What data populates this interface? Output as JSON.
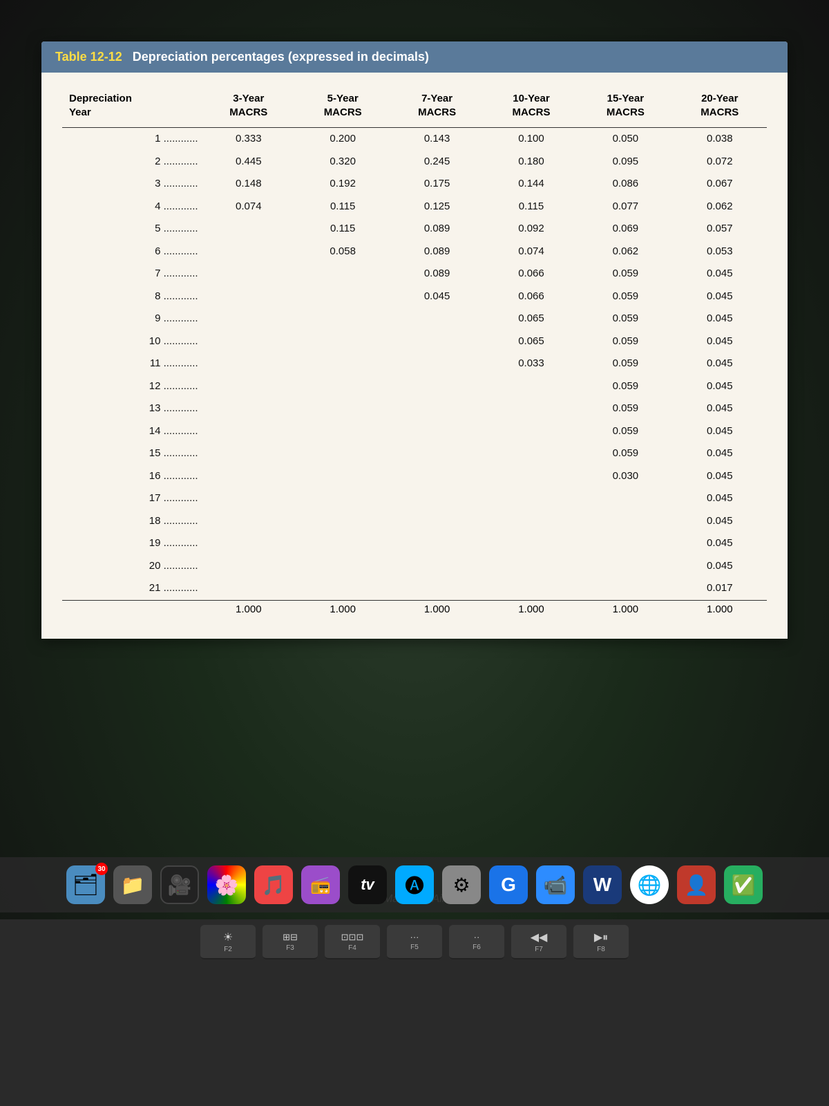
{
  "table": {
    "title_prefix": "Table 12-12",
    "title_text": "Depreciation percentages (expressed in decimals)",
    "columns": [
      {
        "header_line1": "Depreciation",
        "header_line2": "Year"
      },
      {
        "header_line1": "3-Year",
        "header_line2": "MACRS"
      },
      {
        "header_line1": "5-Year",
        "header_line2": "MACRS"
      },
      {
        "header_line1": "7-Year",
        "header_line2": "MACRS"
      },
      {
        "header_line1": "10-Year",
        "header_line2": "MACRS"
      },
      {
        "header_line1": "15-Year",
        "header_line2": "MACRS"
      },
      {
        "header_line1": "20-Year",
        "header_line2": "MACRS"
      }
    ],
    "rows": [
      {
        "year": "1 ............",
        "y3": "0.333",
        "y5": "0.200",
        "y7": "0.143",
        "y10": "0.100",
        "y15": "0.050",
        "y20": "0.038"
      },
      {
        "year": "2 ............",
        "y3": "0.445",
        "y5": "0.320",
        "y7": "0.245",
        "y10": "0.180",
        "y15": "0.095",
        "y20": "0.072"
      },
      {
        "year": "3 ............",
        "y3": "0.148",
        "y5": "0.192",
        "y7": "0.175",
        "y10": "0.144",
        "y15": "0.086",
        "y20": "0.067"
      },
      {
        "year": "4 ............",
        "y3": "0.074",
        "y5": "0.115",
        "y7": "0.125",
        "y10": "0.115",
        "y15": "0.077",
        "y20": "0.062"
      },
      {
        "year": "5 ............",
        "y3": "",
        "y5": "0.115",
        "y7": "0.089",
        "y10": "0.092",
        "y15": "0.069",
        "y20": "0.057"
      },
      {
        "year": "6 ............",
        "y3": "",
        "y5": "0.058",
        "y7": "0.089",
        "y10": "0.074",
        "y15": "0.062",
        "y20": "0.053"
      },
      {
        "year": "7 ............",
        "y3": "",
        "y5": "",
        "y7": "0.089",
        "y10": "0.066",
        "y15": "0.059",
        "y20": "0.045"
      },
      {
        "year": "8 ............",
        "y3": "",
        "y5": "",
        "y7": "0.045",
        "y10": "0.066",
        "y15": "0.059",
        "y20": "0.045"
      },
      {
        "year": "9 ............",
        "y3": "",
        "y5": "",
        "y7": "",
        "y10": "0.065",
        "y15": "0.059",
        "y20": "0.045"
      },
      {
        "year": "10 ............",
        "y3": "",
        "y5": "",
        "y7": "",
        "y10": "0.065",
        "y15": "0.059",
        "y20": "0.045"
      },
      {
        "year": "11 ............",
        "y3": "",
        "y5": "",
        "y7": "",
        "y10": "0.033",
        "y15": "0.059",
        "y20": "0.045"
      },
      {
        "year": "12 ............",
        "y3": "",
        "y5": "",
        "y7": "",
        "y10": "",
        "y15": "0.059",
        "y20": "0.045"
      },
      {
        "year": "13 ............",
        "y3": "",
        "y5": "",
        "y7": "",
        "y10": "",
        "y15": "0.059",
        "y20": "0.045"
      },
      {
        "year": "14 ............",
        "y3": "",
        "y5": "",
        "y7": "",
        "y10": "",
        "y15": "0.059",
        "y20": "0.045"
      },
      {
        "year": "15 ............",
        "y3": "",
        "y5": "",
        "y7": "",
        "y10": "",
        "y15": "0.059",
        "y20": "0.045"
      },
      {
        "year": "16 ............",
        "y3": "",
        "y5": "",
        "y7": "",
        "y10": "",
        "y15": "0.030",
        "y20": "0.045"
      },
      {
        "year": "17 ............",
        "y3": "",
        "y5": "",
        "y7": "",
        "y10": "",
        "y15": "",
        "y20": "0.045"
      },
      {
        "year": "18 ............",
        "y3": "",
        "y5": "",
        "y7": "",
        "y10": "",
        "y15": "",
        "y20": "0.045"
      },
      {
        "year": "19 ............",
        "y3": "",
        "y5": "",
        "y7": "",
        "y10": "",
        "y15": "",
        "y20": "0.045"
      },
      {
        "year": "20 ............",
        "y3": "",
        "y5": "",
        "y7": "",
        "y10": "",
        "y15": "",
        "y20": "0.045"
      },
      {
        "year": "21 ............",
        "y3": "",
        "y5": "",
        "y7": "",
        "y10": "",
        "y15": "",
        "y20": "0.017"
      }
    ],
    "totals": [
      "",
      "1.000",
      "1.000",
      "1.000",
      "1.000",
      "1.000",
      "1.000"
    ]
  },
  "dock": {
    "badge_label": "30",
    "macbook_text": "MacBook Air"
  },
  "keyboard": {
    "keys": [
      {
        "icon": "☀",
        "label": "F2"
      },
      {
        "icon": "⊞",
        "label": "F3"
      },
      {
        "icon": "⊟",
        "label": "F4"
      },
      {
        "icon": "···",
        "label": "F5"
      },
      {
        "icon": "··",
        "label": "F6"
      },
      {
        "icon": "◀◀",
        "label": "F7"
      },
      {
        "icon": "▶⏸",
        "label": "F8"
      }
    ]
  }
}
